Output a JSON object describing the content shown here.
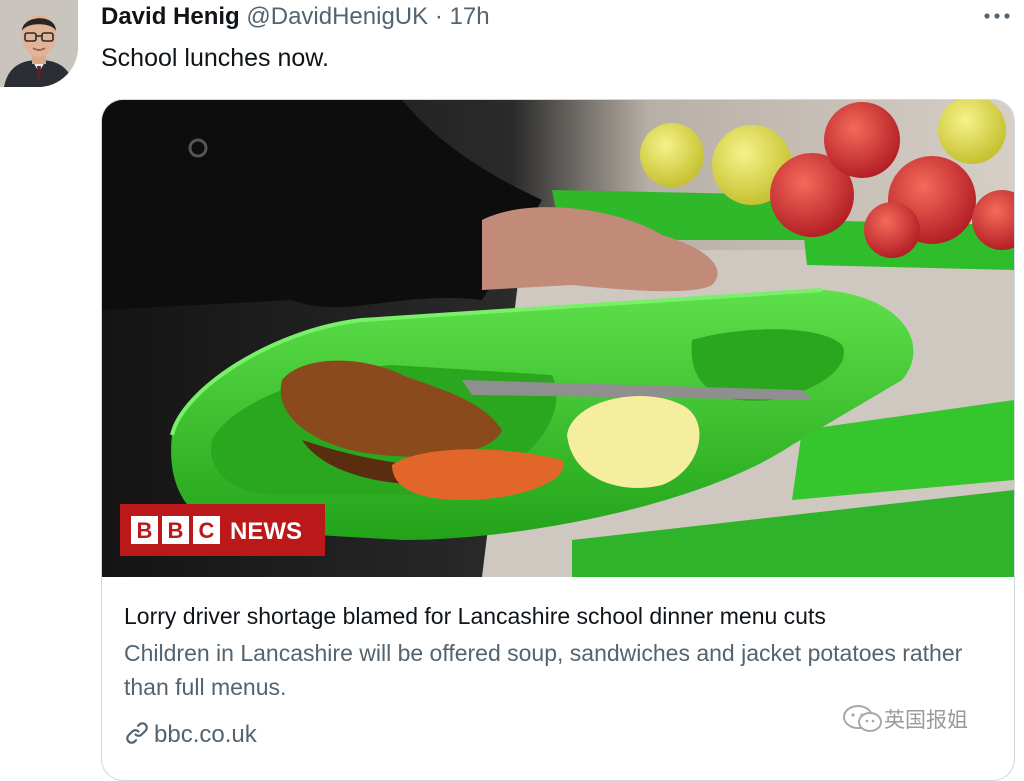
{
  "tweet": {
    "author_name": "David Henig",
    "author_handle": "@DavidHenigUK",
    "separator": "·",
    "time": "17h",
    "text": "School lunches now."
  },
  "card": {
    "image_badge": {
      "left": "BBC",
      "right": "NEWS"
    },
    "title": "Lorry driver shortage blamed for Lancashire school dinner menu cuts",
    "description": "Children in Lancashire will be offered soup, sandwiches and jacket potatoes rather than full menus.",
    "domain": "bbc.co.uk"
  },
  "watermark": {
    "text": "英国报姐"
  },
  "icons": {
    "more": "more-horizontal-icon",
    "link": "link-icon",
    "watermark": "wechat-icon"
  },
  "colors": {
    "secondary_text": "#536471",
    "bbc_red": "#bb1919",
    "tray_green": "#38c62c"
  }
}
